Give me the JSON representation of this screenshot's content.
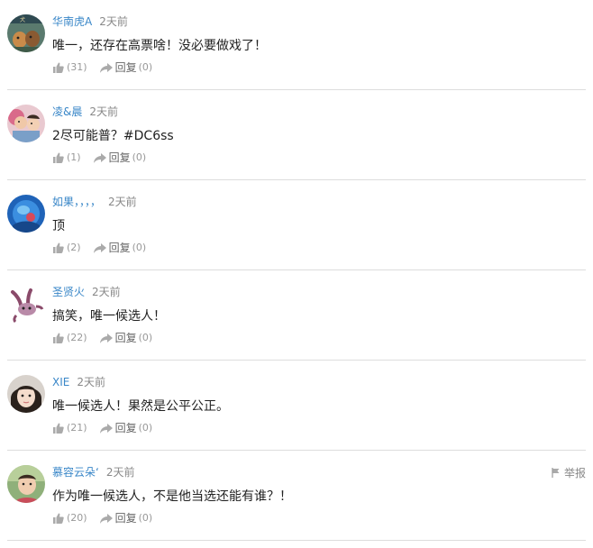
{
  "comments": [
    {
      "username": "华南虎A",
      "time": "2天前",
      "text": "唯一，还存在高票啥！没必要做戏了！",
      "likes": "(31)",
      "reply_label": "回复",
      "replies": "(0)",
      "avatar_icon": "dog-photo-avatar"
    },
    {
      "username": "凌&晨",
      "time": "2天前",
      "text": "2尽可能普？#DC6ss",
      "likes": "(1)",
      "reply_label": "回复",
      "replies": "(0)",
      "avatar_icon": "children-photo-avatar"
    },
    {
      "username": "如果，，，，",
      "time": "2天前",
      "text": "顶",
      "likes": "(2)",
      "reply_label": "回复",
      "replies": "(0)",
      "avatar_icon": "blue-abstract-avatar"
    },
    {
      "username": "圣贤火",
      "time": "2天前",
      "text": "搞笑，唯一候选人！",
      "likes": "(22)",
      "reply_label": "回复",
      "replies": "(0)",
      "avatar_icon": "cartoon-rabbit-avatar"
    },
    {
      "username": "XIE",
      "time": "2天前",
      "text": "唯一候选人！果然是公平公正。",
      "likes": "(21)",
      "reply_label": "回复",
      "replies": "(0)",
      "avatar_icon": "girl-photo-avatar"
    },
    {
      "username": "慕容云朵‘",
      "time": "2天前",
      "text": "作为唯一候选人，不是他当选还能有谁？！",
      "likes": "(20)",
      "reply_label": "回复",
      "replies": "(0)",
      "avatar_icon": "child-photo-avatar",
      "report_label": "举报"
    }
  ],
  "colors": {
    "username": "#3a87c8",
    "divider": "#dddddd",
    "muted": "#999999"
  }
}
